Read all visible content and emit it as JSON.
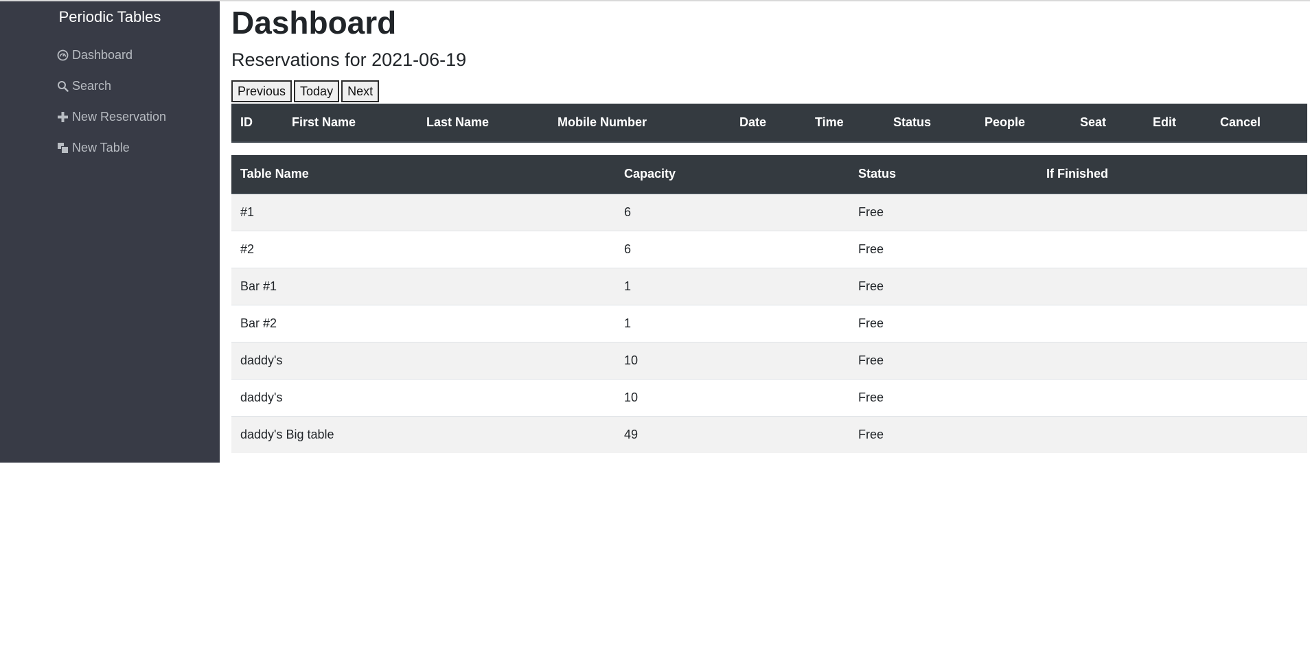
{
  "sidebar": {
    "brand": "Periodic Tables",
    "items": [
      {
        "label": "Dashboard",
        "icon": "dashboard-icon"
      },
      {
        "label": "Search",
        "icon": "search-icon"
      },
      {
        "label": "New Reservation",
        "icon": "plus-icon"
      },
      {
        "label": "New Table",
        "icon": "table-icon"
      }
    ]
  },
  "main": {
    "title": "Dashboard",
    "subtitle": "Reservations for 2021-06-19",
    "buttons": {
      "previous": "Previous",
      "today": "Today",
      "next": "Next"
    },
    "reservations": {
      "headers": [
        "ID",
        "First Name",
        "Last Name",
        "Mobile Number",
        "Date",
        "Time",
        "Status",
        "People",
        "Seat",
        "Edit",
        "Cancel"
      ],
      "rows": []
    },
    "tables": {
      "headers": [
        "Table Name",
        "Capacity",
        "Status",
        "If Finished"
      ],
      "rows": [
        [
          "#1",
          "6",
          "Free",
          ""
        ],
        [
          "#2",
          "6",
          "Free",
          ""
        ],
        [
          "Bar #1",
          "1",
          "Free",
          ""
        ],
        [
          "Bar #2",
          "1",
          "Free",
          ""
        ],
        [
          "daddy's",
          "10",
          "Free",
          ""
        ],
        [
          "daddy's",
          "10",
          "Free",
          ""
        ],
        [
          "daddy's Big table",
          "49",
          "Free",
          ""
        ]
      ]
    }
  },
  "colors": {
    "sidebar_bg": "#383b46",
    "table_header_bg": "#343a40",
    "nav_text": "#b8bcc2",
    "stripe": "#f2f2f2"
  }
}
